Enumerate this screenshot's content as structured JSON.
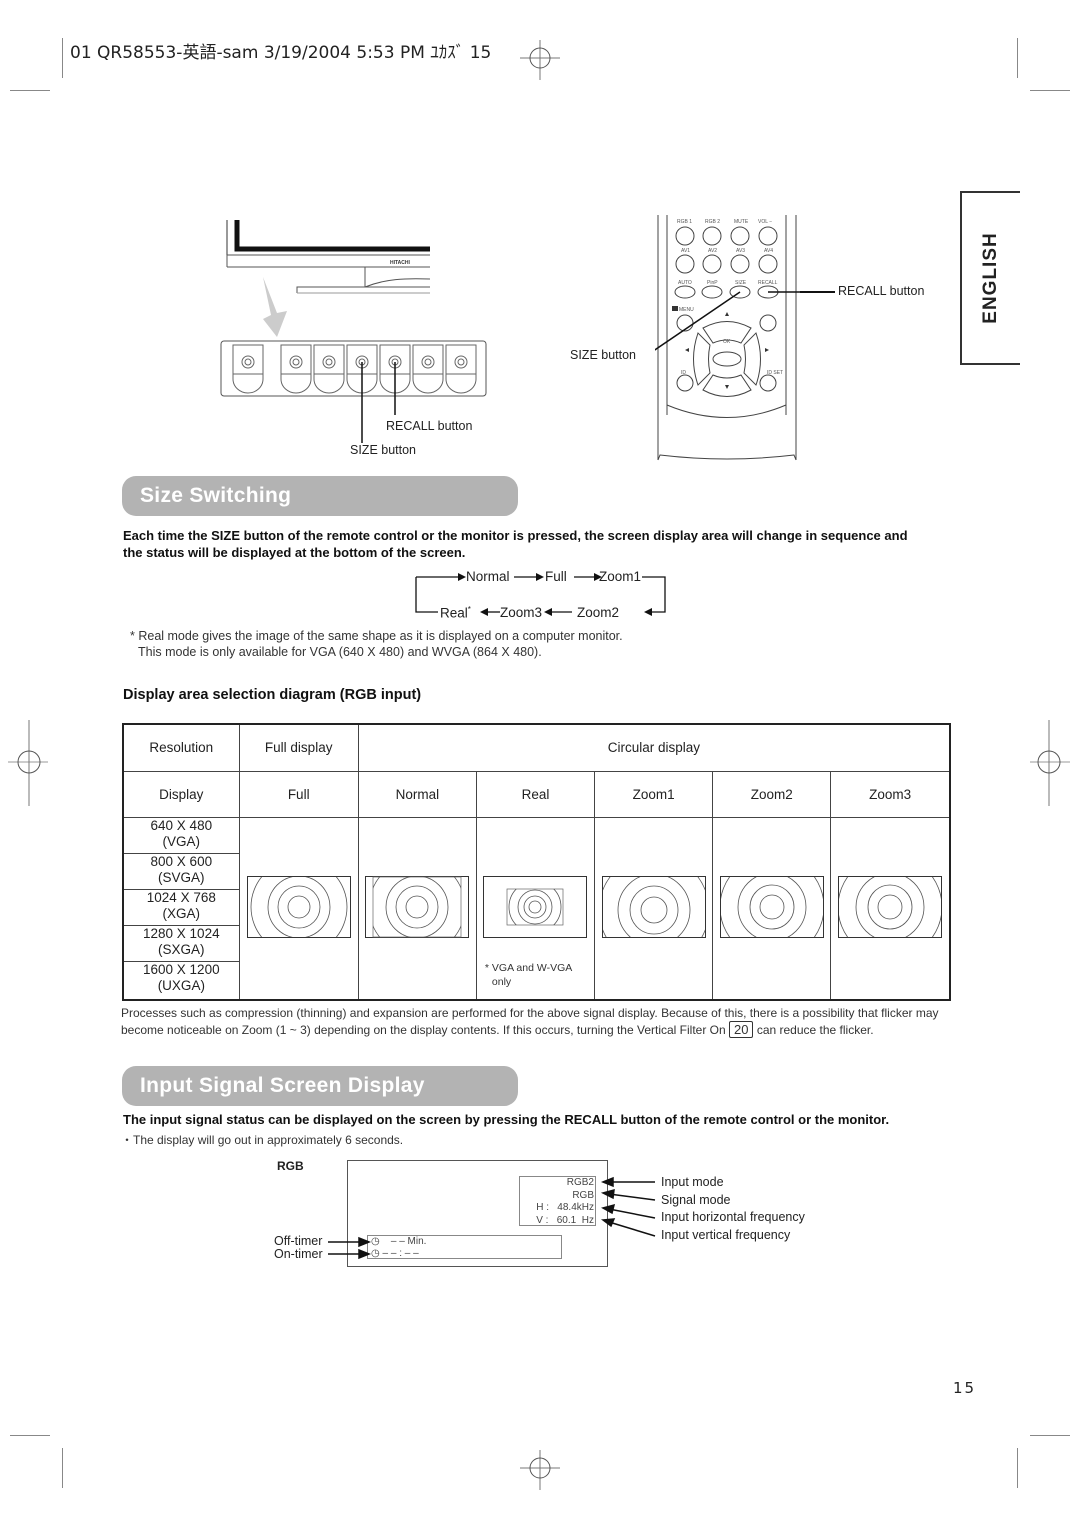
{
  "header": {
    "slug": "01 QR58553-英語-sam 3/19/2004 5:53 PM ﾕｶｽﾞ 15"
  },
  "language_tab": "ENGLISH",
  "monitor_figure": {
    "brand": "HITACHI",
    "callouts": [
      "RECALL button",
      "SIZE button"
    ]
  },
  "remote_figure": {
    "rows": [
      [
        "RGB 1",
        "RGB 2",
        "MUTE",
        "VOL −"
      ],
      [
        "AV1",
        "AV2",
        "AV3",
        "AV4"
      ],
      [
        "AUTO",
        "PinP",
        "SIZE",
        "RECALL"
      ]
    ],
    "menu_label": "MENU",
    "ok_label": "OK",
    "id_label": "ID",
    "idset_label": "ID SET",
    "callouts": {
      "recall": "RECALL button",
      "size": "SIZE button"
    }
  },
  "size_switching": {
    "title": "Size Switching",
    "intro": "Each time the SIZE button of the remote control or the monitor is pressed, the screen display area will change in sequence and the status will be displayed at the bottom of the screen.",
    "cycle_top": [
      "Normal",
      "Full",
      "Zoom1"
    ],
    "cycle_bottom": [
      "Real",
      "Zoom3",
      "Zoom2"
    ],
    "real_asterisk": "*",
    "footnote_1": "* Real mode gives the image of the same shape as it is displayed on a computer monitor.",
    "footnote_2": "This mode is only available for VGA (640 X 480) and WVGA (864 X 480)."
  },
  "diagram": {
    "title": "Display area selection diagram (RGB input)",
    "header_row1": {
      "resolution": "Resolution",
      "full_display": "Full display",
      "circular_display": "Circular display"
    },
    "header_row2": [
      "Display",
      "Full",
      "Normal",
      "Real",
      "Zoom1",
      "Zoom2",
      "Zoom3"
    ],
    "resolutions": [
      {
        "size": "640 X 480",
        "name": "(VGA)"
      },
      {
        "size": "800 X 600",
        "name": "(SVGA)"
      },
      {
        "size": "1024 X 768",
        "name": "(XGA)"
      },
      {
        "size": "1280 X 1024",
        "name": "(SXGA)"
      },
      {
        "size": "1600 X 1200",
        "name": "(UXGA)"
      }
    ],
    "real_note_1": "* VGA and W-VGA",
    "real_note_2": "only"
  },
  "flicker_note": {
    "text_before": "Processes such as compression (thinning) and expansion are performed for the above signal display. Because of this, there is a possibility that flicker may become noticeable on Zoom (1 ~ 3) depending on the display contents. If this occurs, turning the Vertical Filter On",
    "page_ref": "20",
    "text_after": "can reduce the flicker."
  },
  "input_signal": {
    "title": "Input Signal Screen Display",
    "intro": "The input signal status can be displayed on the screen by pressing the RECALL button of the remote control or the monitor.",
    "bullet": "・The display will go out in approximately 6 seconds.",
    "osd_label": "RGB",
    "osd_lines": [
      "RGB2",
      "RGB",
      "H :   48.4kHz",
      "V :   60.1  Hz"
    ],
    "timer_off": "– – Min.",
    "timer_on": "– – : – –",
    "left_labels": [
      "Off-timer",
      "On-timer"
    ],
    "right_labels": [
      "Input mode",
      "Signal mode",
      "Input horizontal frequency",
      "Input vertical frequency"
    ]
  },
  "page_number": "15"
}
